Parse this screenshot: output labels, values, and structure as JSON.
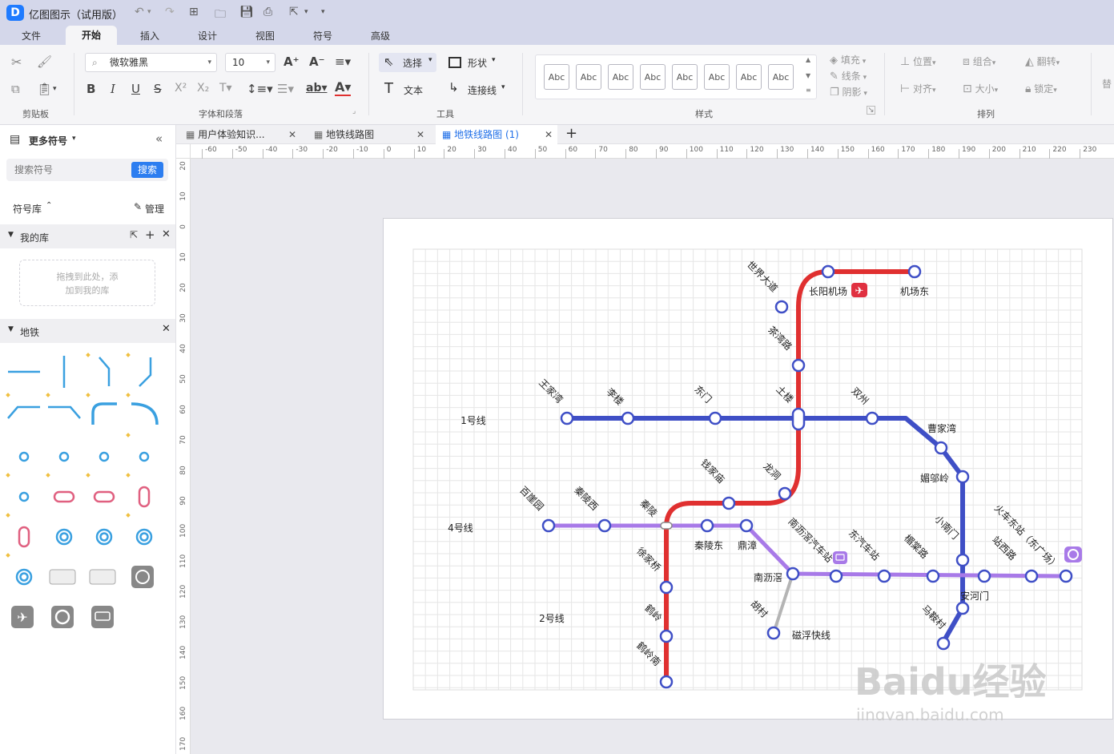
{
  "app": {
    "title": "亿图图示（试用版）",
    "logo_char": "D"
  },
  "menu": [
    "文件",
    "开始",
    "插入",
    "设计",
    "视图",
    "符号",
    "高级"
  ],
  "menu_active": 1,
  "ribbon": {
    "font_name": "微软雅黑",
    "font_size": "10",
    "select": "选择",
    "shape": "形状",
    "text": "文本",
    "connector": "连接线",
    "fill": "填充",
    "line": "线条",
    "shadow": "阴影",
    "position": "位置",
    "group": "组合",
    "flip": "翻转",
    "align": "对齐",
    "size": "大小",
    "lock": "锁定",
    "style_sample": "Abc",
    "more": "替",
    "groups": {
      "clipboard": "剪贴板",
      "font": "字体和段落",
      "tools": "工具",
      "styles": "样式",
      "arrange": "排列"
    }
  },
  "tabs": [
    {
      "label": "用户体验知识..."
    },
    {
      "label": "地铁线路图"
    },
    {
      "label": "地铁线路图 (1)"
    }
  ],
  "sidebar": {
    "title": "更多符号",
    "search_placeholder": "搜索符号",
    "search_btn": "搜索",
    "library": "符号库",
    "manage": "管理",
    "my_lib": "我的库",
    "drop_hint_1": "拖拽到此处，添",
    "drop_hint_2": "加到我的库",
    "metro_lib": "地铁"
  },
  "ruler": {
    "h": [
      "-60",
      "-50",
      "-40",
      "-30",
      "-20",
      "-10",
      "0",
      "10",
      "20",
      "30",
      "40",
      "50",
      "60",
      "70",
      "80",
      "90",
      "100",
      "110",
      "120",
      "130",
      "140",
      "150",
      "160",
      "170",
      "180",
      "190",
      "200",
      "210",
      "220",
      "230"
    ],
    "v": [
      "20",
      "10",
      "0",
      "10",
      "20",
      "30",
      "40",
      "50",
      "60",
      "70",
      "80",
      "90",
      "100",
      "110",
      "120",
      "130",
      "140",
      "150",
      "160",
      "170"
    ]
  },
  "map": {
    "colors": {
      "line1": "#3f4fc6",
      "line2": "#e03030",
      "line4": "#a87ae8",
      "maglev": "#b4b4b4",
      "grid": "#e6e6e6"
    },
    "line_labels": [
      "1号线",
      "4号线",
      "2号线"
    ],
    "stations": [
      "世界大道",
      "长阳机场",
      "机场东",
      "茶湾路",
      "王家湾",
      "李楼",
      "东门",
      "土楼",
      "双州",
      "曹家湾",
      "媚邬岭",
      "钱家庙",
      "龙洞",
      "百崖园",
      "秦陵西",
      "秦陵",
      "秦陵东",
      "鼎漳",
      "南沥滘汽车站",
      "东汽车站",
      "楣棠路",
      "小南门",
      "站西路",
      "火车东站（东广场）",
      "安河门",
      "南沥滘",
      "胡村",
      "磁浮快线",
      "徐家桥",
      "鹤岭",
      "鹤岭南",
      "马鞍村"
    ]
  },
  "watermark": {
    "brand": "Baidu经验",
    "url": "jingyan.baidu.com"
  }
}
